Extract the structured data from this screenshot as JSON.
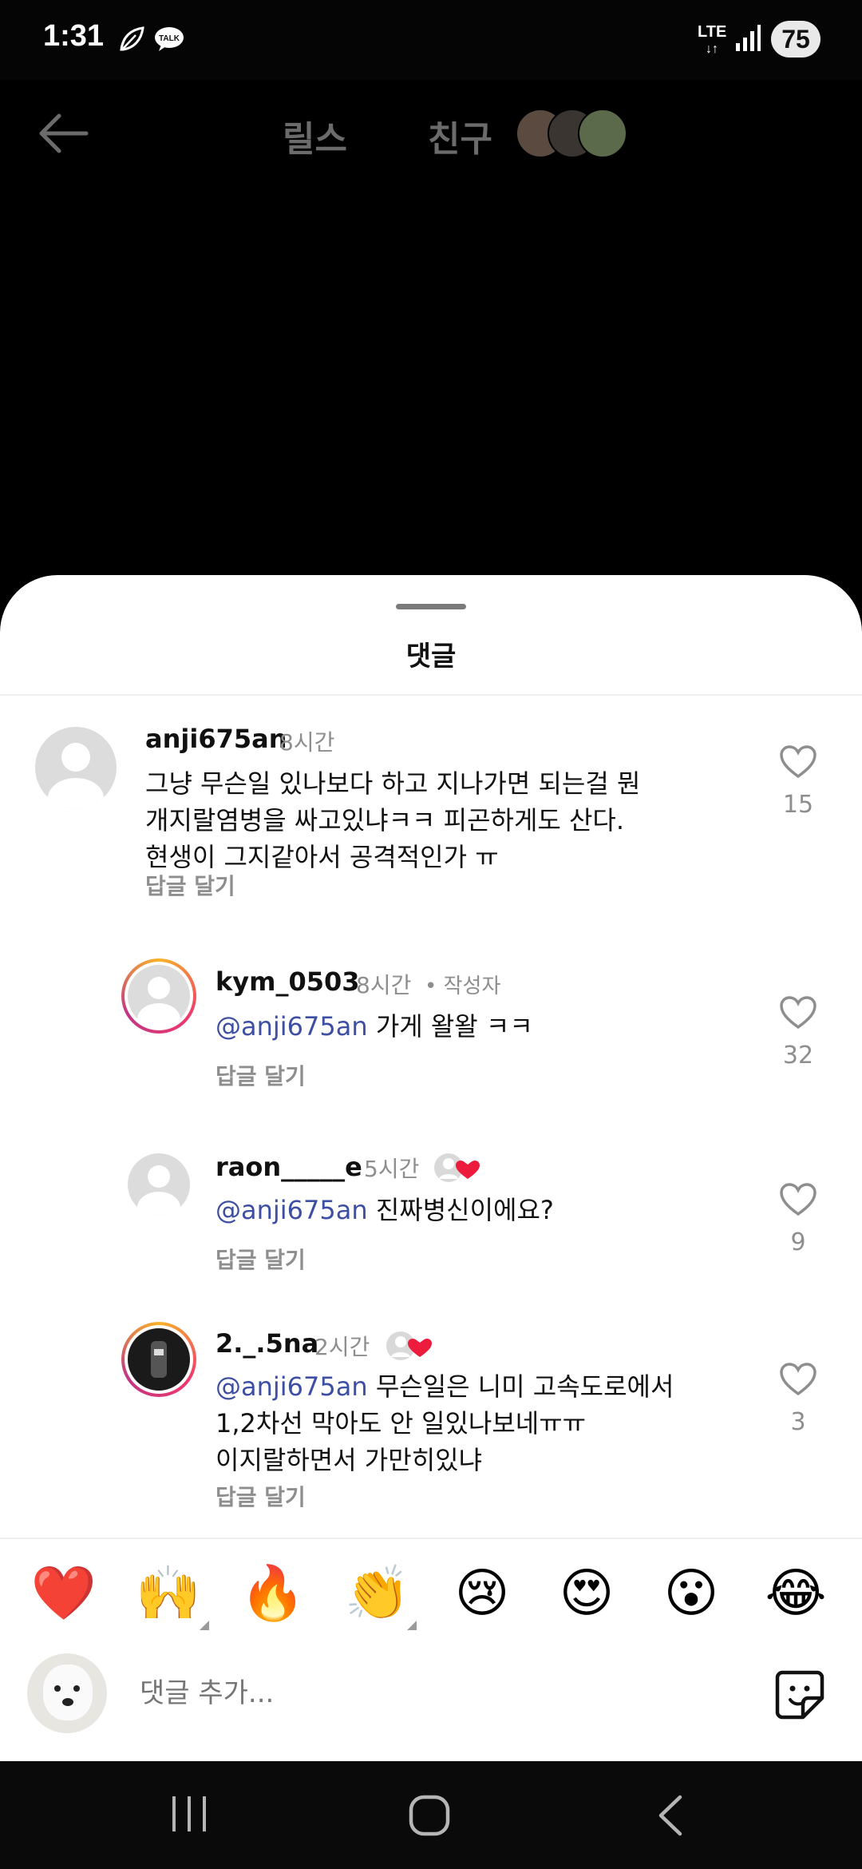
{
  "status_bar": {
    "time": "1:31",
    "network": "LTE",
    "battery": "75"
  },
  "top_nav": {
    "tab_reels": "릴스",
    "tab_friends": "친구"
  },
  "sheet": {
    "title": "댓글"
  },
  "comments": [
    {
      "username": "anji675an",
      "time": "8시간",
      "text_lines": [
        "그냥 무슨일 있나보다 하고 지나가면 되는걸 뭔",
        "개지랄염병을 싸고있냐ㅋㅋ 피곤하게도 산다.",
        "현생이 그지같아서 공격적인가 ㅠ"
      ],
      "reply_label": "답글 달기",
      "likes": "15"
    },
    {
      "username": "kym_0503",
      "time": "8시간",
      "author_label": "• 작성자",
      "mention": "@anji675an",
      "text": " 가게 왈왈 ㅋㅋ",
      "reply_label": "답글 달기",
      "likes": "32"
    },
    {
      "username": "raon_____e",
      "time": "5시간",
      "mention": "@anji675an",
      "text": " 진짜병신이에요?",
      "reply_label": "답글 달기",
      "likes": "9"
    },
    {
      "username": "2._.5na",
      "time": "2시간",
      "mention": "@anji675an",
      "text_lines": [
        " 무슨일은 니미 고속도로에서",
        "1,2차선 막아도 안 일있나보네ㅠㅠ",
        "이지랄하면서 가만히있냐"
      ],
      "reply_label": "답글 달기",
      "likes": "3"
    }
  ],
  "emojis": [
    "❤️",
    "🙌",
    "🔥",
    "👏",
    "😢",
    "😍",
    "😮",
    "😂"
  ],
  "input": {
    "placeholder": "댓글 추가..."
  }
}
